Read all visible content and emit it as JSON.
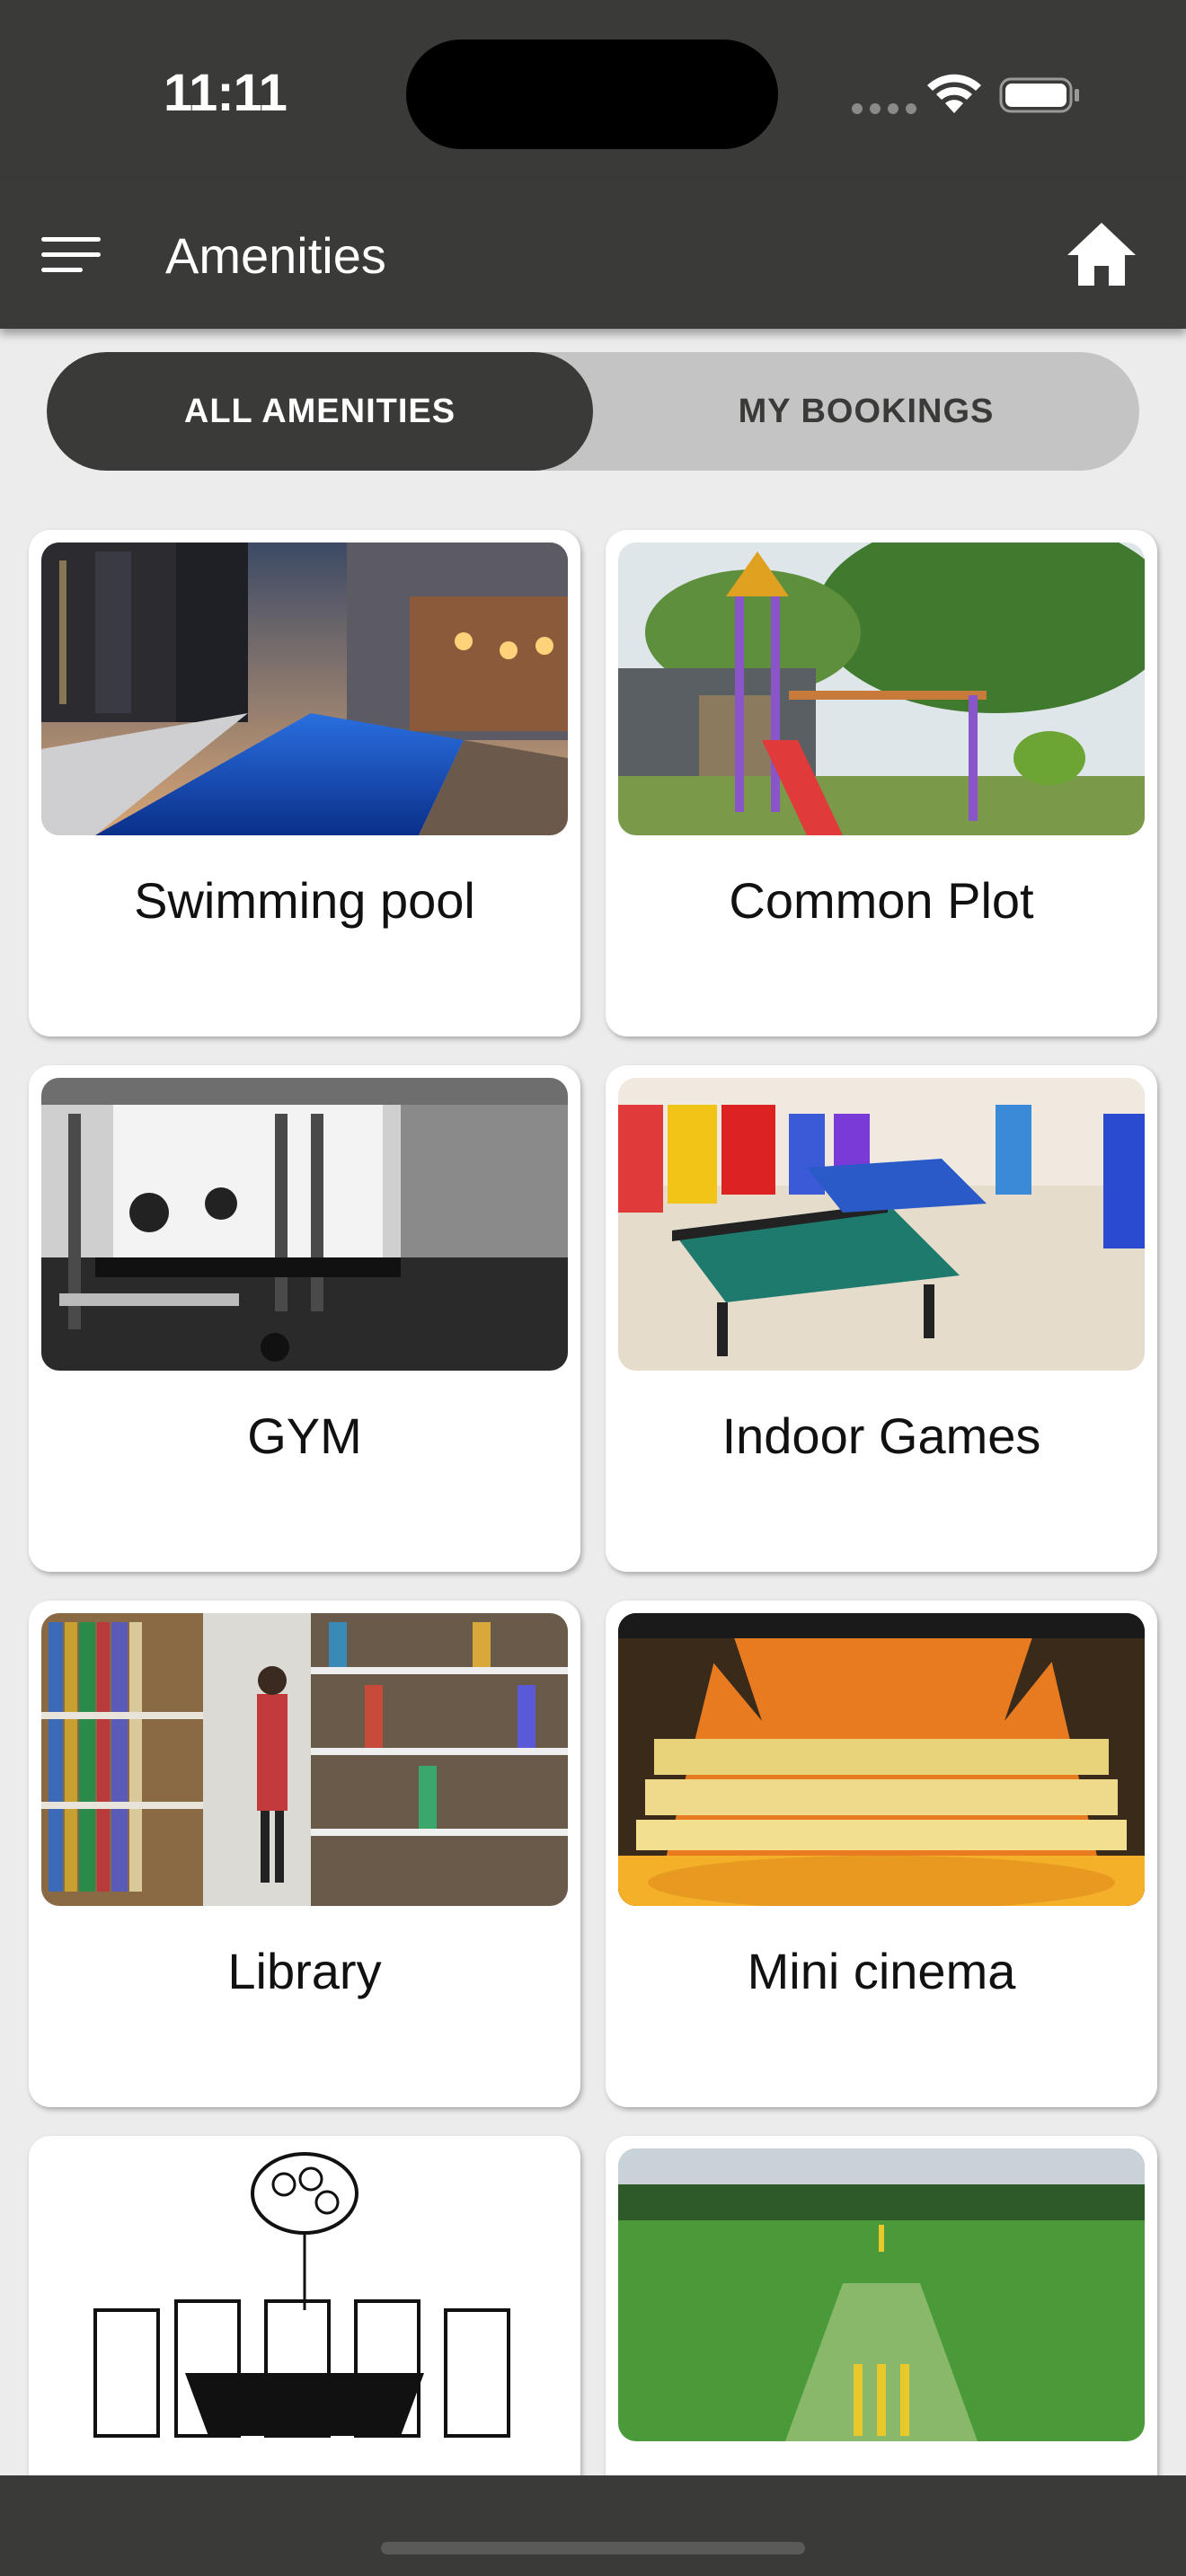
{
  "status_bar": {
    "time": "11:11"
  },
  "app_bar": {
    "title": "Amenities"
  },
  "tabs": [
    {
      "label": "ALL AMENITIES",
      "selected": true
    },
    {
      "label": "MY BOOKINGS",
      "selected": false
    }
  ],
  "amenities": [
    {
      "name": "Swimming pool"
    },
    {
      "name": "Common Plot"
    },
    {
      "name": "GYM"
    },
    {
      "name": "Indoor Games"
    },
    {
      "name": "Library"
    },
    {
      "name": "Mini cinema"
    },
    {
      "name": ""
    },
    {
      "name": ""
    }
  ],
  "colors": {
    "bar": "#3a3a38",
    "background": "#ececec",
    "segment_inactive": "#c4c4c4"
  }
}
